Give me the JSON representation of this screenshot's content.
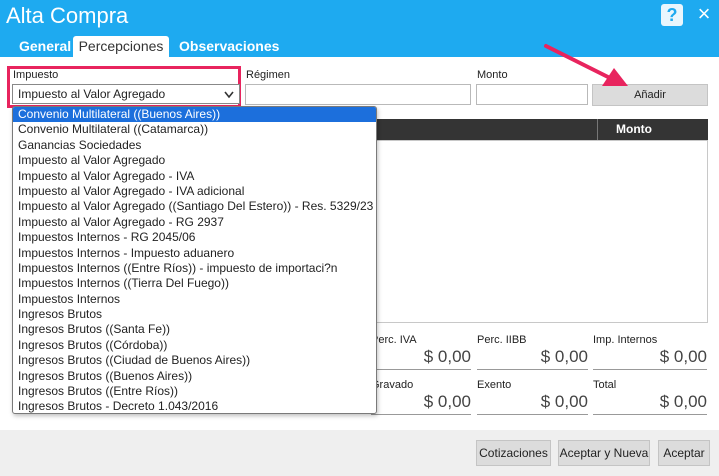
{
  "window": {
    "title": "Alta Compra",
    "help_label": "?",
    "close_label": "×"
  },
  "tabs": [
    {
      "label": "General",
      "active": false
    },
    {
      "label": "Percepciones",
      "active": true
    },
    {
      "label": "Observaciones",
      "active": false
    }
  ],
  "form": {
    "impuesto_label": "Impuesto",
    "impuesto_value": "Impuesto al Valor Agregado",
    "regimen_label": "Régimen",
    "regimen_value": "",
    "monto_label": "Monto",
    "monto_value": "",
    "add_button": "Añadir"
  },
  "table": {
    "columns": [
      "Monto"
    ],
    "rows": []
  },
  "totals": {
    "iva_label": "Perc. IVA",
    "iva_value": "$ 0,00",
    "iibb_label": "Perc. IIBB",
    "iibb_value": "$ 0,00",
    "internos_label": "Imp. Internos",
    "internos_value": "$ 0,00",
    "gravado_label": "Gravado",
    "gravado_value": "$ 0,00",
    "exento_label": "Exento",
    "exento_value": "$ 0,00",
    "total_label": "Total",
    "total_value": "$ 0,00"
  },
  "dropdown": {
    "options": [
      "Convenio Multilateral ((Buenos Aires))",
      "Convenio Multilateral ((Catamarca))",
      "Ganancias Sociedades",
      "Impuesto al Valor Agregado",
      "Impuesto al Valor Agregado - IVA",
      "Impuesto al Valor Agregado - IVA adicional",
      "Impuesto al Valor Agregado ((Santiago Del Estero)) - Res. 5329/23",
      "Impuesto al Valor Agregado - RG 2937",
      "Impuestos Internos - RG 2045/06",
      "Impuestos Internos - Impuesto aduanero",
      "Impuestos Internos ((Entre Ríos)) - impuesto de importaci?n",
      "Impuestos Internos ((Tierra Del Fuego))",
      "Impuestos Internos",
      "Ingresos Brutos",
      "Ingresos Brutos ((Santa Fe))",
      "Ingresos Brutos ((Córdoba))",
      "Ingresos Brutos ((Ciudad de Buenos Aires))",
      "Ingresos Brutos ((Buenos Aires))",
      "Ingresos Brutos ((Entre Ríos))",
      "Ingresos Brutos - Decreto 1.043/2016"
    ],
    "highlighted_index": 0
  },
  "footer": {
    "cotizaciones": "Cotizaciones",
    "aceptar_nueva": "Aceptar y Nueva",
    "aceptar": "Aceptar"
  },
  "colors": {
    "header": "#1eaaf0",
    "highlight_box": "#e8245e",
    "selected_option": "#1c6fdc"
  }
}
